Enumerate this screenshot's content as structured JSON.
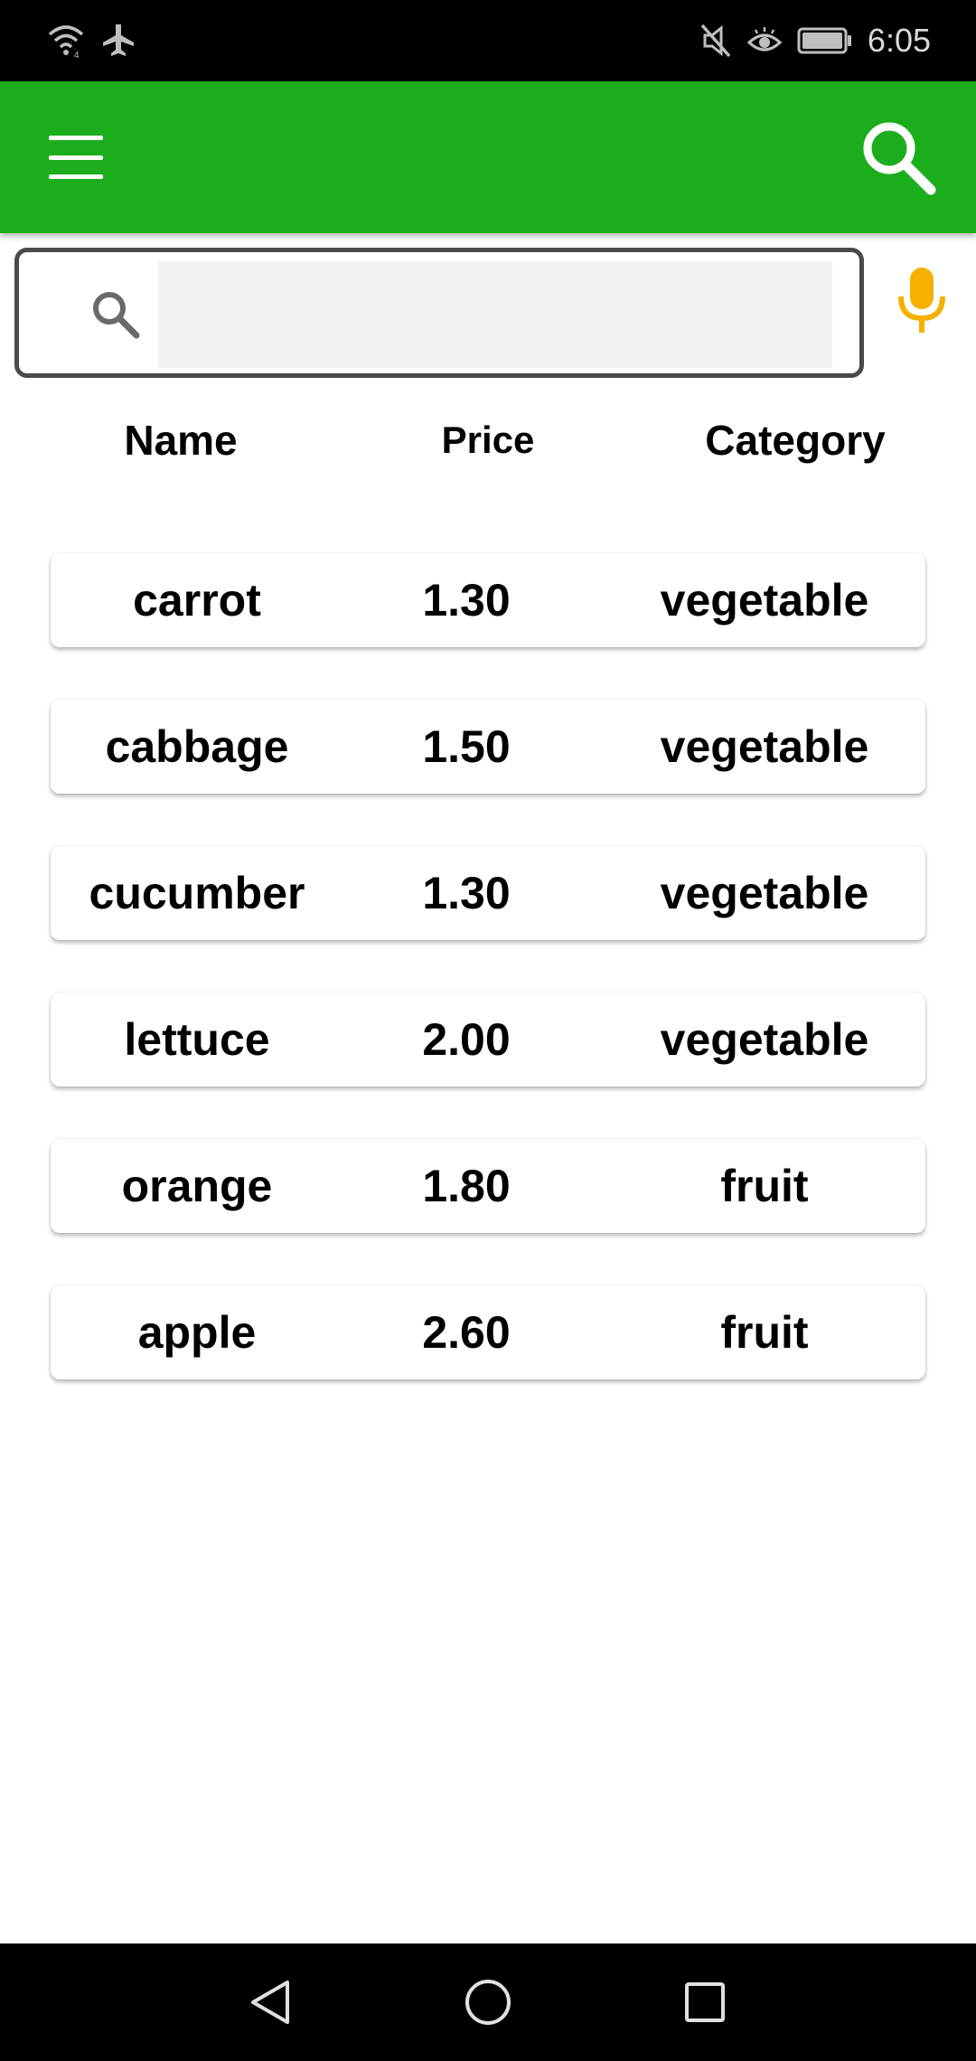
{
  "status_bar": {
    "time": "6:05",
    "icons": [
      "wifi-icon",
      "airplane-icon",
      "mute-icon",
      "eye-icon",
      "battery-icon"
    ]
  },
  "app_bar": {
    "color": "#1cad1c",
    "menu_icon": "menu-icon",
    "search_icon": "search-icon"
  },
  "search": {
    "value": "",
    "placeholder": "",
    "accent": "#f5b000"
  },
  "table": {
    "headers": {
      "name": "Name",
      "price": "Price",
      "category": "Category"
    },
    "rows": [
      {
        "name": "carrot",
        "price": "1.30",
        "category": "vegetable"
      },
      {
        "name": "cabbage",
        "price": "1.50",
        "category": "vegetable"
      },
      {
        "name": "cucumber",
        "price": "1.30",
        "category": "vegetable"
      },
      {
        "name": "lettuce",
        "price": "2.00",
        "category": "vegetable"
      },
      {
        "name": "orange",
        "price": "1.80",
        "category": "fruit"
      },
      {
        "name": "apple",
        "price": "2.60",
        "category": "fruit"
      }
    ]
  },
  "nav_bar": {
    "icons": [
      "back-icon",
      "home-icon",
      "recents-icon"
    ]
  }
}
